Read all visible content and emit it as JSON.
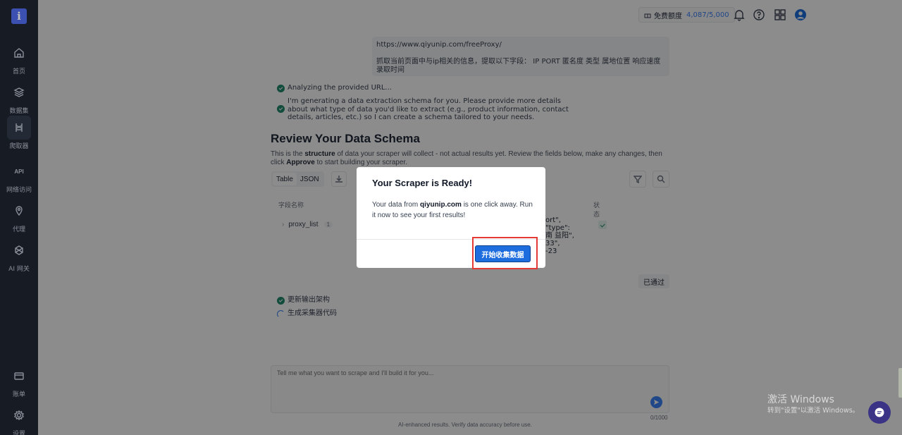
{
  "sidebar": {
    "logo": "i",
    "items": [
      {
        "label": "首页",
        "icon": "home-icon"
      },
      {
        "label": "数据集",
        "icon": "layers-icon"
      },
      {
        "label": "爬取器",
        "icon": "scraper-icon"
      },
      {
        "label": "网络访问",
        "icon": "api-icon"
      },
      {
        "label": "代理",
        "icon": "location-icon"
      },
      {
        "label": "AI 网关",
        "icon": "ai-gateway-icon"
      }
    ],
    "bottom_items": [
      {
        "label": "账单",
        "icon": "billing-icon"
      },
      {
        "label": "设置",
        "icon": "settings-icon"
      }
    ],
    "active_item": "爬取器"
  },
  "topbar": {
    "quota_label": "免费额度",
    "quota_value": "4,087/5,000"
  },
  "chat": {
    "user_url": "https://www.qiyunip.com/freeProxy/",
    "user_instruction": "抓取当前页面中与ip相关的信息，提取以下字段： IP     PORT     匿名度     类型 属地位置  响应速度     录取时间",
    "status_analyzing": "Analyzing the provided URL...",
    "status_generating": "I'm generating a data extraction schema for you. Please provide more details about what type of data you'd like to extract (e.g., product information, contact details, articles, etc.) so I can create a schema tailored to your needs.",
    "status_update_schema": "更新输出架构",
    "status_generate_code": "生成采集器代码"
  },
  "schema": {
    "title": "Review Your Data Schema",
    "desc_prefix": "This is the ",
    "desc_bold1": "structure",
    "desc_mid": " of data your scraper will collect - not actual results yet. Review the fields below, make any changes, then click ",
    "desc_bold2": "Approve",
    "desc_suffix": " to start building your scraper.",
    "tabs": [
      "Table",
      "JSON"
    ],
    "columns": {
      "field_name": "字段名称",
      "status": "状态"
    },
    "rows": [
      {
        "name": "proxy_list",
        "count": "1"
      }
    ],
    "peek_lines": [
      "ort\",",
      "\"type\":",
      "南 益阳\",",
      "33\",",
      "-23"
    ],
    "passed_label": "已通过"
  },
  "input": {
    "placeholder": "Tell me what you want to scrape and I'll build it for you...",
    "counter": "0/1000",
    "disclaimer": "AI-enhanced results. Verify data accuracy before use."
  },
  "modal": {
    "title": "Your Scraper is Ready!",
    "body_prefix": "Your data from ",
    "body_domain": "qiyunip.com",
    "body_suffix": " is one click away. Run it now to see your first results!",
    "button_label": "开始收集数据"
  },
  "watermark": {
    "title": "激活 Windows",
    "subtitle": "转到\"设置\"以激活 Windows。"
  },
  "colors": {
    "sidebar_bg": "#1f2430",
    "accent_blue": "#1d6ddf",
    "success_green": "#1f8a70",
    "highlight_red": "#e53935"
  }
}
